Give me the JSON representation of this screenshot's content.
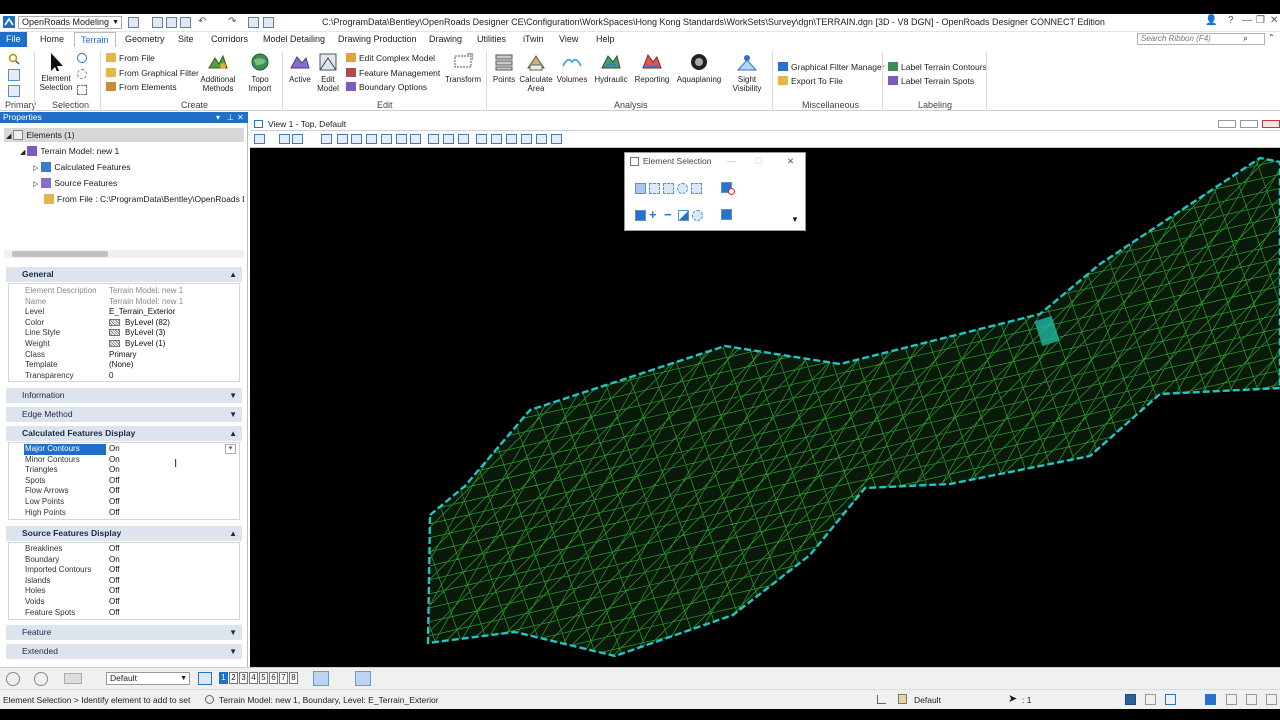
{
  "window": {
    "workspace": "OpenRoads Modeling",
    "title": "C:\\ProgramData\\Bentley\\OpenRoads Designer CE\\Configuration\\WorkSpaces\\Hong Kong Standards\\WorkSets\\Survey\\dgn\\TERRAIN.dgn [3D - V8 DGN] - OpenRoads Designer CONNECT Edition"
  },
  "tabs": [
    "File",
    "Home",
    "Terrain",
    "Geometry",
    "Site",
    "Corridors",
    "Model Detailing",
    "Drawing Production",
    "Drawing",
    "Utilities",
    "iTwin",
    "View",
    "Help"
  ],
  "active_tab": "Terrain",
  "search": {
    "placeholder": "Search Ribbon (F4)"
  },
  "ribbon": {
    "groups": {
      "primary": "Primary",
      "selection": "Selection",
      "create": "Create",
      "edit": "Edit",
      "analysis": "Analysis",
      "miscellaneous": "Miscellaneous",
      "labeling": "Labeling"
    },
    "element_selection": "Element\nSelection",
    "create_items": [
      "From File",
      "From Graphical Filter",
      "From Elements"
    ],
    "additional_methods": "Additional\nMethods",
    "topo_import": "Topo\nImport",
    "active": "Active",
    "edit_model": "Edit\nModel",
    "edit_items": [
      "Edit Complex Model",
      "Feature Management",
      "Boundary Options"
    ],
    "transform": "Transform",
    "analysis_items": [
      "Points",
      "Calculate\nArea",
      "Volumes",
      "Hydraulic",
      "Reporting",
      "Aquaplaning",
      "Sight\nVisibility"
    ],
    "misc_items": [
      "Graphical Filter Manager",
      "Export To File"
    ],
    "label_items": [
      "Label Terrain Contours",
      "Label Terrain Spots"
    ]
  },
  "properties": {
    "title": "Properties",
    "tree": {
      "root": "Elements (1)",
      "model": "Terrain Model: new 1",
      "children": [
        "Calculated Features",
        "Source Features",
        "From File : C:\\ProgramData\\Bentley\\OpenRoads Des"
      ]
    },
    "general": {
      "title": "General",
      "rows": [
        {
          "k": "Element Description",
          "v": "Terrain Model: new 1"
        },
        {
          "k": "Name",
          "v": "Terrain Model: new 1"
        },
        {
          "k": "Level",
          "v": "E_Terrain_Exterior"
        },
        {
          "k": "Color",
          "v": "ByLevel (82)"
        },
        {
          "k": "Line Style",
          "v": "ByLevel (3)"
        },
        {
          "k": "Weight",
          "v": "ByLevel (1)"
        },
        {
          "k": "Class",
          "v": "Primary"
        },
        {
          "k": "Template",
          "v": "(None)"
        },
        {
          "k": "Transparency",
          "v": "0"
        }
      ]
    },
    "information": "Information",
    "edge_method": "Edge Method",
    "calculated": {
      "title": "Calculated Features Display",
      "rows": [
        {
          "k": "Major Contours",
          "v": "On"
        },
        {
          "k": "Minor Contours",
          "v": "On"
        },
        {
          "k": "Triangles",
          "v": "On"
        },
        {
          "k": "Spots",
          "v": "Off"
        },
        {
          "k": "Flow Arrows",
          "v": "Off"
        },
        {
          "k": "Low Points",
          "v": "Off"
        },
        {
          "k": "High Points",
          "v": "Off"
        }
      ]
    },
    "source": {
      "title": "Source Features Display",
      "rows": [
        {
          "k": "Breaklines",
          "v": "Off"
        },
        {
          "k": "Boundary",
          "v": "On"
        },
        {
          "k": "Imported Contours",
          "v": "Off"
        },
        {
          "k": "Islands",
          "v": "Off"
        },
        {
          "k": "Holes",
          "v": "Off"
        },
        {
          "k": "Voids",
          "v": "Off"
        },
        {
          "k": "Feature Spots",
          "v": "Off"
        }
      ]
    },
    "feature": "Feature",
    "extended": "Extended"
  },
  "view": {
    "title": "View 1 - Top, Default"
  },
  "dialog": {
    "title": "Element Selection"
  },
  "status": {
    "level": "Default",
    "view_numbers": [
      "1",
      "2",
      "3",
      "4",
      "5",
      "6",
      "7",
      "8"
    ],
    "prompt": "Element Selection > Identify element to add to set",
    "message": "Terrain Model: new 1, Boundary, Level: E_Terrain_Exterior",
    "active_level": "Default",
    "scale": ": 1"
  },
  "colors": {
    "accent": "#1f6fc9",
    "mesh": "#2f9e2f",
    "boundary": "#22c4c4"
  }
}
